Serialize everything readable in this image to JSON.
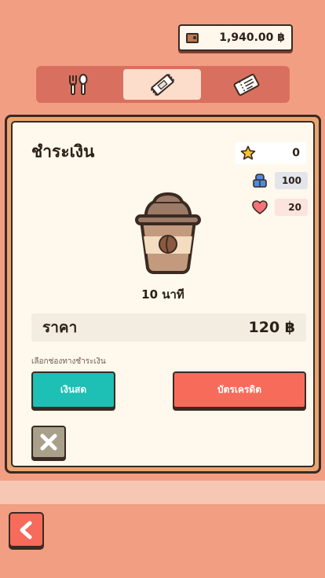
{
  "header": {
    "balance": "1,940.00 ฿",
    "wallet_icon": "wallet-icon"
  },
  "tabs": [
    {
      "name": "food",
      "icon": "fork-spoon-icon",
      "active": false
    },
    {
      "name": "snack",
      "icon": "snack-bar-icon",
      "active": true
    },
    {
      "name": "ticket",
      "icon": "ticket-icon",
      "active": false
    }
  ],
  "payment": {
    "title": "ชำระเงิน",
    "stats": {
      "stars": "0",
      "energy": "100",
      "hearts": "20"
    },
    "item_icon": "coffee-cup-icon",
    "duration": "10 นาที",
    "price_label": "ราคา",
    "price_value": "120 ฿",
    "method_label": "เลือกช่องทางชำระเงิน",
    "cash_label": "เงินสด",
    "card_label": "บัตรเครดิต"
  },
  "colors": {
    "background": "#F29E82",
    "tab_bar": "#D9705F",
    "panel_frame": "#E8A571",
    "cash_button": "#1EBFB4",
    "card_button": "#F76B5B",
    "close_button": "#A9A08C"
  }
}
